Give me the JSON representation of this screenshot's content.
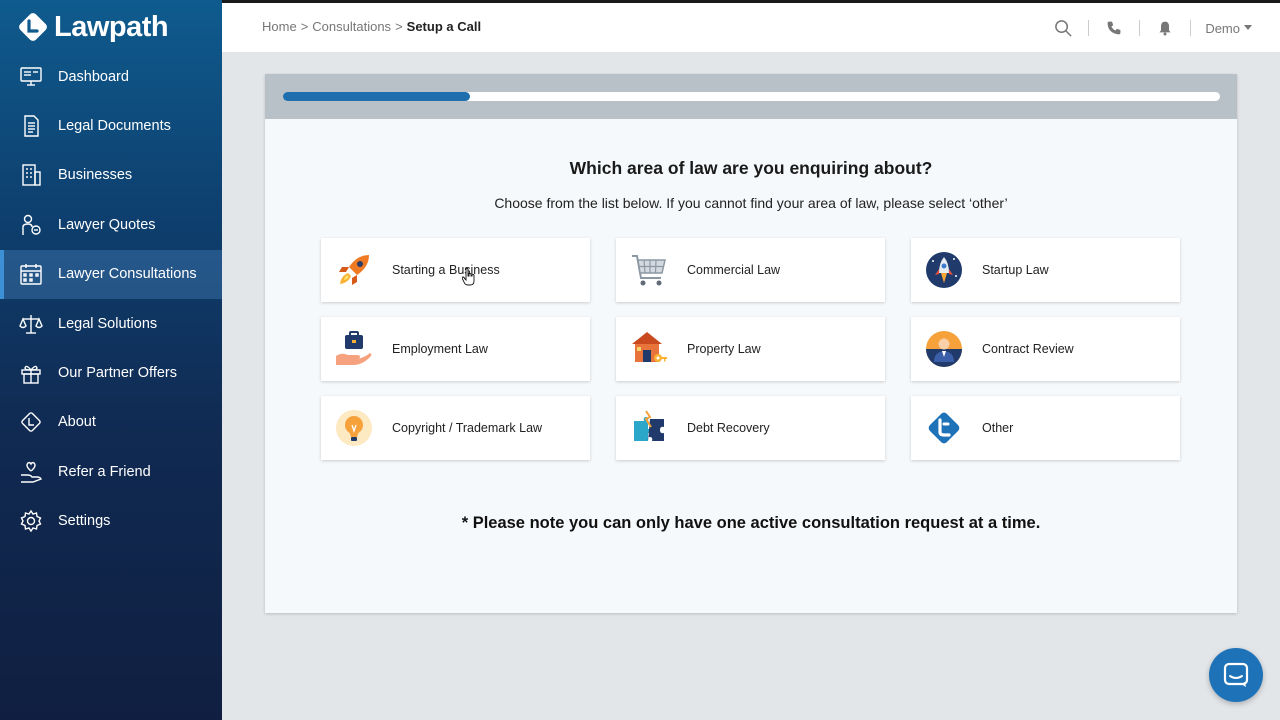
{
  "app": {
    "logo_text": "Lawpath"
  },
  "sidebar": {
    "items": [
      {
        "label": "Dashboard",
        "icon": "dashboard-icon",
        "active": false
      },
      {
        "label": "Legal Documents",
        "icon": "document-icon",
        "active": false
      },
      {
        "label": "Businesses",
        "icon": "building-icon",
        "active": false
      },
      {
        "label": "Lawyer Quotes",
        "icon": "lawyer-quote-icon",
        "active": false
      },
      {
        "label": "Lawyer Consultations",
        "icon": "calendar-icon",
        "active": true
      },
      {
        "label": "Legal Solutions",
        "icon": "scales-icon",
        "active": false
      },
      {
        "label": "Our Partner Offers",
        "icon": "gift-icon",
        "active": false
      },
      {
        "label": "About",
        "icon": "about-logo-icon",
        "active": false
      },
      {
        "label": "Refer a Friend",
        "icon": "heart-hand-icon",
        "active": false
      },
      {
        "label": "Settings",
        "icon": "gear-icon",
        "active": false
      }
    ]
  },
  "topbar": {
    "breadcrumb": {
      "home": "Home",
      "sep1": ">",
      "consultations": "Consultations",
      "sep2": ">",
      "current": "Setup a Call"
    },
    "user": "Demo"
  },
  "wizard": {
    "progress_fraction": 0.2,
    "question": "Which area of law are you enquiring about?",
    "instruction": "Choose from the list below. If you cannot find your area of law, please select ‘other’",
    "options": [
      {
        "label": "Starting a Business",
        "icon": "rocket-icon"
      },
      {
        "label": "Commercial Law",
        "icon": "shopping-cart-icon"
      },
      {
        "label": "Startup Law",
        "icon": "startup-rocket-icon"
      },
      {
        "label": "Employment Law",
        "icon": "briefcase-hand-icon"
      },
      {
        "label": "Property Law",
        "icon": "house-key-icon"
      },
      {
        "label": "Contract Review",
        "icon": "person-sunset-icon"
      },
      {
        "label": "Copyright / Trademark Law",
        "icon": "lightbulb-icon"
      },
      {
        "label": "Debt Recovery",
        "icon": "puzzle-icon"
      },
      {
        "label": "Other",
        "icon": "lawpath-logo-icon"
      }
    ],
    "note": "* Please note you can only have one active consultation request at a time."
  },
  "colors": {
    "accent": "#1f6fae",
    "sidebar_top": "#0f5b8e",
    "sidebar_bottom": "#101f41"
  }
}
